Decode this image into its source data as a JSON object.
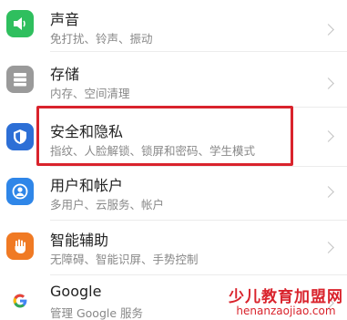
{
  "settings": {
    "items": [
      {
        "title": "声音",
        "subtitle": "免打扰、铃声、振动",
        "icon": "speaker-icon",
        "color": "#2fbf5e"
      },
      {
        "title": "存储",
        "subtitle": "内存、空间清理",
        "icon": "storage-icon",
        "color": "#9a9a9a"
      },
      {
        "title": "安全和隐私",
        "subtitle": "指纹、人脸解锁、锁屏和密码、学生模式",
        "icon": "shield-icon",
        "color": "#2d6fd6"
      },
      {
        "title": "用户和帐户",
        "subtitle": "多用户、云服务、帐户",
        "icon": "user-icon",
        "color": "#2f86e8"
      },
      {
        "title": "智能辅助",
        "subtitle": "无障碍、智能识屏、手势控制",
        "icon": "hand-icon",
        "color": "#f07a24"
      },
      {
        "title": "Google",
        "subtitle": "管理 Google 服务",
        "icon": "google-icon",
        "color": "#ffffff"
      }
    ],
    "highlight_color": "#d9232c"
  },
  "watermark": {
    "line1": "少儿教育加盟网",
    "line2": "henanzaojiao.com"
  }
}
